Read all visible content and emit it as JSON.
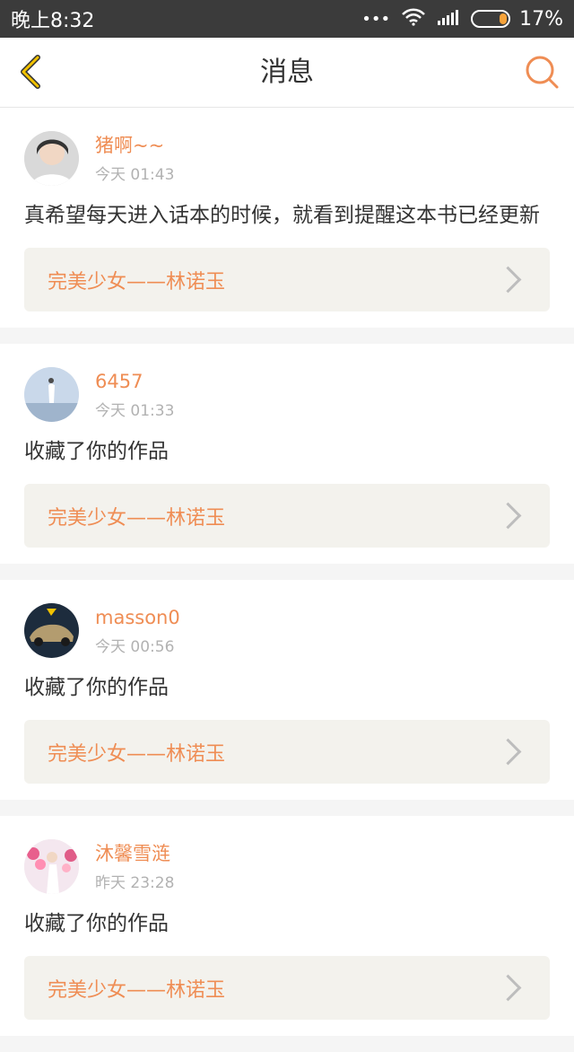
{
  "status_bar": {
    "time": "晚上8:32",
    "battery_percent": "17%",
    "signal_icon": "signal-icon",
    "wifi_icon": "wifi-icon",
    "battery_icon": "battery-icon"
  },
  "header": {
    "title": "消息",
    "back_icon": "back-chevron-icon",
    "search_icon": "search-icon"
  },
  "colors": {
    "accent": "#ef8d54",
    "status_bar_bg": "#3b3b3b",
    "card_bg": "#ffffff",
    "book_bg": "#f3f2ed"
  },
  "messages": [
    {
      "username": "猪啊~~",
      "time": "今天 01:43",
      "content": "真希望每天进入话本的时候，就看到提醒这本书已经更新",
      "book_title": "完美少女——林诺玉"
    },
    {
      "username": "6457",
      "time": "今天 01:33",
      "content": "收藏了你的作品",
      "book_title": "完美少女——林诺玉"
    },
    {
      "username": "masson0",
      "time": "今天 00:56",
      "content": "收藏了你的作品",
      "book_title": "完美少女——林诺玉"
    },
    {
      "username": "沐馨雪涟",
      "time": "昨天 23:28",
      "content": "收藏了你的作品",
      "book_title": "完美少女——林诺玉"
    }
  ]
}
